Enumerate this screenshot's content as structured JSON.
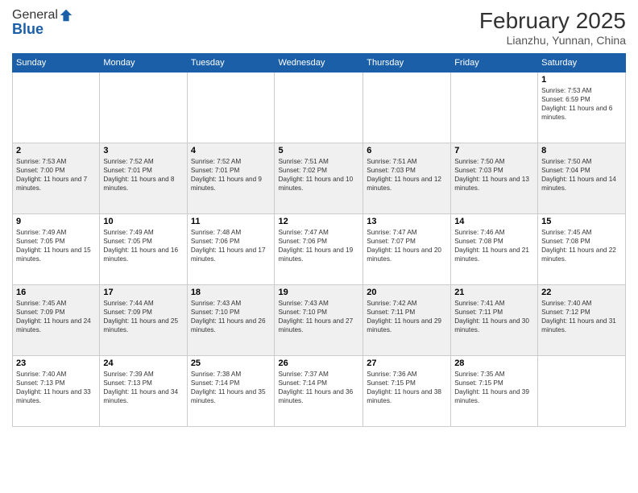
{
  "header": {
    "logo_general": "General",
    "logo_blue": "Blue",
    "month_title": "February 2025",
    "location": "Lianzhu, Yunnan, China"
  },
  "weekdays": [
    "Sunday",
    "Monday",
    "Tuesday",
    "Wednesday",
    "Thursday",
    "Friday",
    "Saturday"
  ],
  "weeks": [
    [
      {
        "day": "",
        "info": ""
      },
      {
        "day": "",
        "info": ""
      },
      {
        "day": "",
        "info": ""
      },
      {
        "day": "",
        "info": ""
      },
      {
        "day": "",
        "info": ""
      },
      {
        "day": "",
        "info": ""
      },
      {
        "day": "1",
        "info": "Sunrise: 7:53 AM\nSunset: 6:59 PM\nDaylight: 11 hours and 6 minutes."
      }
    ],
    [
      {
        "day": "2",
        "info": "Sunrise: 7:53 AM\nSunset: 7:00 PM\nDaylight: 11 hours and 7 minutes."
      },
      {
        "day": "3",
        "info": "Sunrise: 7:52 AM\nSunset: 7:01 PM\nDaylight: 11 hours and 8 minutes."
      },
      {
        "day": "4",
        "info": "Sunrise: 7:52 AM\nSunset: 7:01 PM\nDaylight: 11 hours and 9 minutes."
      },
      {
        "day": "5",
        "info": "Sunrise: 7:51 AM\nSunset: 7:02 PM\nDaylight: 11 hours and 10 minutes."
      },
      {
        "day": "6",
        "info": "Sunrise: 7:51 AM\nSunset: 7:03 PM\nDaylight: 11 hours and 12 minutes."
      },
      {
        "day": "7",
        "info": "Sunrise: 7:50 AM\nSunset: 7:03 PM\nDaylight: 11 hours and 13 minutes."
      },
      {
        "day": "8",
        "info": "Sunrise: 7:50 AM\nSunset: 7:04 PM\nDaylight: 11 hours and 14 minutes."
      }
    ],
    [
      {
        "day": "9",
        "info": "Sunrise: 7:49 AM\nSunset: 7:05 PM\nDaylight: 11 hours and 15 minutes."
      },
      {
        "day": "10",
        "info": "Sunrise: 7:49 AM\nSunset: 7:05 PM\nDaylight: 11 hours and 16 minutes."
      },
      {
        "day": "11",
        "info": "Sunrise: 7:48 AM\nSunset: 7:06 PM\nDaylight: 11 hours and 17 minutes."
      },
      {
        "day": "12",
        "info": "Sunrise: 7:47 AM\nSunset: 7:06 PM\nDaylight: 11 hours and 19 minutes."
      },
      {
        "day": "13",
        "info": "Sunrise: 7:47 AM\nSunset: 7:07 PM\nDaylight: 11 hours and 20 minutes."
      },
      {
        "day": "14",
        "info": "Sunrise: 7:46 AM\nSunset: 7:08 PM\nDaylight: 11 hours and 21 minutes."
      },
      {
        "day": "15",
        "info": "Sunrise: 7:45 AM\nSunset: 7:08 PM\nDaylight: 11 hours and 22 minutes."
      }
    ],
    [
      {
        "day": "16",
        "info": "Sunrise: 7:45 AM\nSunset: 7:09 PM\nDaylight: 11 hours and 24 minutes."
      },
      {
        "day": "17",
        "info": "Sunrise: 7:44 AM\nSunset: 7:09 PM\nDaylight: 11 hours and 25 minutes."
      },
      {
        "day": "18",
        "info": "Sunrise: 7:43 AM\nSunset: 7:10 PM\nDaylight: 11 hours and 26 minutes."
      },
      {
        "day": "19",
        "info": "Sunrise: 7:43 AM\nSunset: 7:10 PM\nDaylight: 11 hours and 27 minutes."
      },
      {
        "day": "20",
        "info": "Sunrise: 7:42 AM\nSunset: 7:11 PM\nDaylight: 11 hours and 29 minutes."
      },
      {
        "day": "21",
        "info": "Sunrise: 7:41 AM\nSunset: 7:11 PM\nDaylight: 11 hours and 30 minutes."
      },
      {
        "day": "22",
        "info": "Sunrise: 7:40 AM\nSunset: 7:12 PM\nDaylight: 11 hours and 31 minutes."
      }
    ],
    [
      {
        "day": "23",
        "info": "Sunrise: 7:40 AM\nSunset: 7:13 PM\nDaylight: 11 hours and 33 minutes."
      },
      {
        "day": "24",
        "info": "Sunrise: 7:39 AM\nSunset: 7:13 PM\nDaylight: 11 hours and 34 minutes."
      },
      {
        "day": "25",
        "info": "Sunrise: 7:38 AM\nSunset: 7:14 PM\nDaylight: 11 hours and 35 minutes."
      },
      {
        "day": "26",
        "info": "Sunrise: 7:37 AM\nSunset: 7:14 PM\nDaylight: 11 hours and 36 minutes."
      },
      {
        "day": "27",
        "info": "Sunrise: 7:36 AM\nSunset: 7:15 PM\nDaylight: 11 hours and 38 minutes."
      },
      {
        "day": "28",
        "info": "Sunrise: 7:35 AM\nSunset: 7:15 PM\nDaylight: 11 hours and 39 minutes."
      },
      {
        "day": "",
        "info": ""
      }
    ]
  ]
}
